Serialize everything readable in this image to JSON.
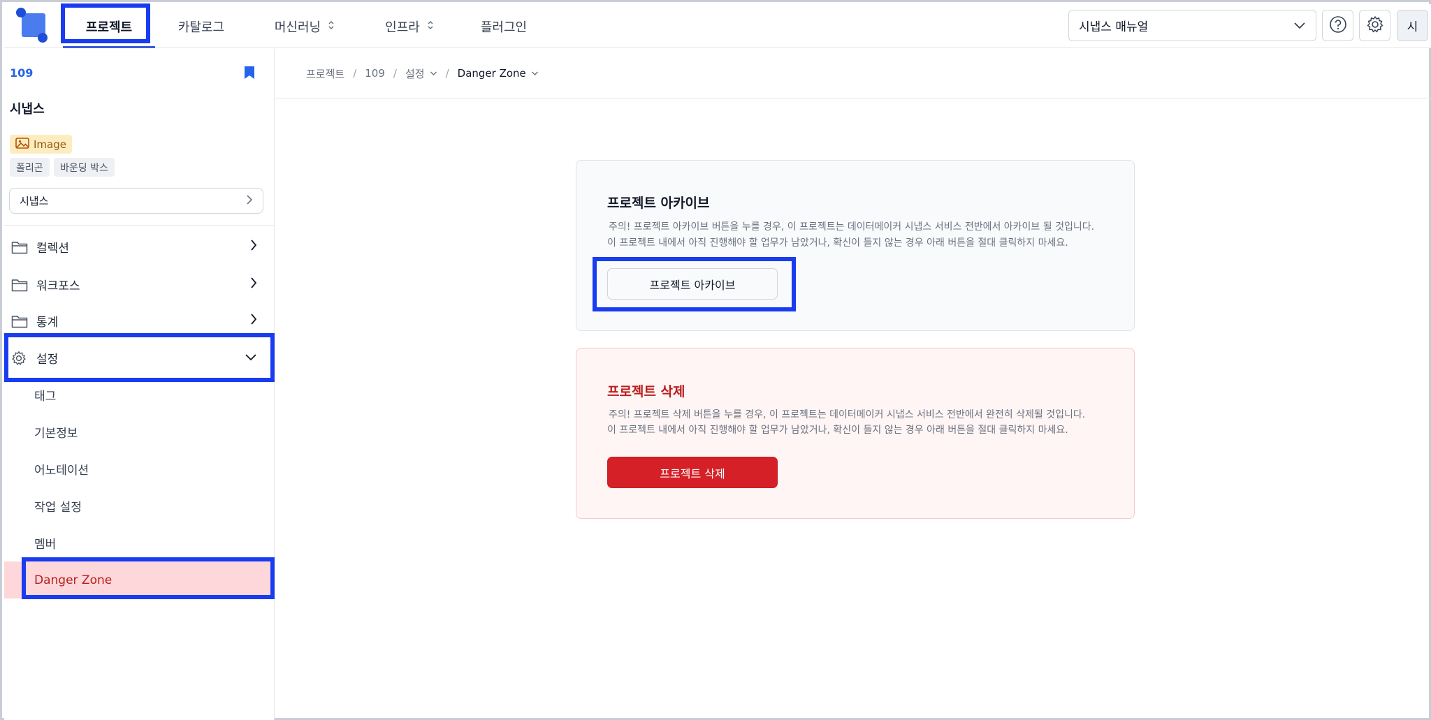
{
  "topnav": {
    "items": [
      {
        "label": "프로젝트",
        "active": true
      },
      {
        "label": "카탈로그"
      },
      {
        "label": "머신러닝",
        "dropdown": true
      },
      {
        "label": "인프라",
        "dropdown": true
      },
      {
        "label": "플러그인"
      }
    ],
    "manual_select": "시냅스 매뉴얼",
    "user_initial": "시",
    "icons": [
      "help-icon",
      "settings-icon"
    ]
  },
  "sidebar": {
    "project_id": "109",
    "project_name": "시냅스",
    "data_type": "Image",
    "annotation_tags": [
      "폴리곤",
      "바운딩 박스"
    ],
    "workspace": "시냅스",
    "menu": [
      {
        "label": "컬렉션",
        "icon": "folder-icon"
      },
      {
        "label": "워크포스",
        "icon": "folder-icon"
      },
      {
        "label": "통계",
        "icon": "folder-icon"
      },
      {
        "label": "설정",
        "icon": "gear-icon",
        "expanded": true
      }
    ],
    "settings_sub": [
      {
        "label": "태그"
      },
      {
        "label": "기본정보"
      },
      {
        "label": "어노테이션"
      },
      {
        "label": "작업 설정"
      },
      {
        "label": "멤버"
      },
      {
        "label": "Danger Zone",
        "active": true
      }
    ]
  },
  "breadcrumb": [
    "프로젝트",
    "109",
    "설정",
    "Danger Zone"
  ],
  "archive": {
    "title": "프로젝트 아카이브",
    "line1": "주의! 프로젝트 아카이브 버튼을 누를 경우, 이 프로젝트는 데이터메이커 시냅스 서비스 전반에서 아카이브 될 것입니다.",
    "line2": "이 프로젝트 내에서 아직 진행해야 할 업무가 남았거나, 확신이 들지 않는 경우 아래 버튼을 절대 클릭하지 마세요.",
    "button": "프로젝트 아카이브"
  },
  "delete": {
    "title": "프로젝트 삭제",
    "line1": "주의! 프로젝트 삭제 버튼을 누를 경우, 이 프로젝트는 데이터메이커 시냅스 서비스 전반에서 완전히 삭제될 것입니다.",
    "line2": "이 프로젝트 내에서 아직 진행해야 할 업무가 남았거나, 확신이 들지 않는 경우 아래 버튼을 절대 클릭하지 마세요.",
    "button": "프로젝트 삭제"
  },
  "colors": {
    "accent": "#2563eb",
    "highlight": "#1a3cf0",
    "danger": "#d42026",
    "danger_bg": "#fff5f5",
    "active_row": "#fdd7d9"
  }
}
